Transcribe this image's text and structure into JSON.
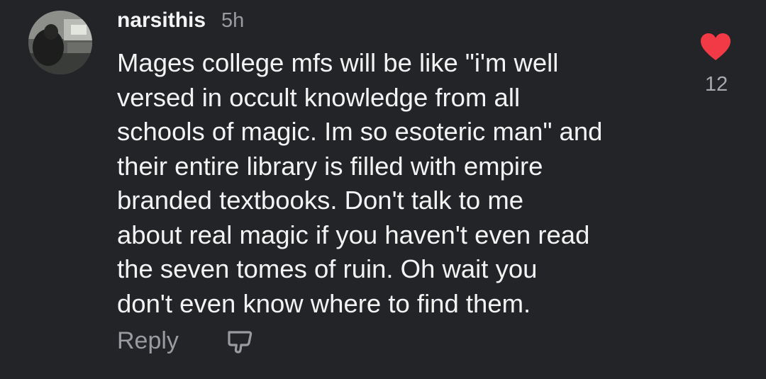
{
  "comment": {
    "username": "narsithis",
    "timestamp": "5h",
    "text": "Mages college mfs will be like \"i'm well\nversed in occult knowledge from all\nschools of magic. Im so esoteric man\" and\ntheir entire library is filled with empire\nbranded textbooks. Don't talk to me\nabout real magic if you haven't even read\nthe seven tomes of ruin. Oh wait you\ndon't even know where to find them.",
    "reply_label": "Reply",
    "like_count": "12",
    "icons": {
      "like": "heart-icon",
      "dislike": "dislike-icon",
      "avatar": "avatar-photo"
    },
    "colors": {
      "background": "#232428",
      "heart": "#f23a46",
      "muted": "#9a9ba0"
    }
  }
}
